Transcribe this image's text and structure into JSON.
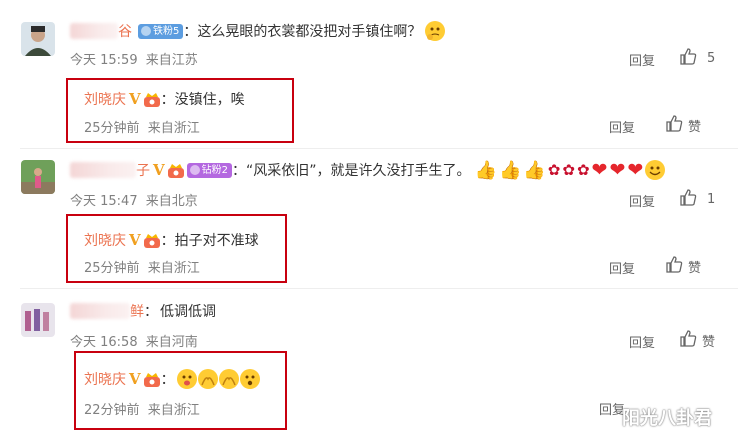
{
  "comments": [
    {
      "user_visible": "谷",
      "badge": "铁粉5",
      "text": "这么晃眼的衣裳都没把对手镇住啊？",
      "time": "今天 15:59",
      "location": "来自江苏",
      "reply_label": "回复",
      "like_count": "5",
      "reply": {
        "user": "刘晓庆",
        "text": "没镇住，唉",
        "time": "25分钟前",
        "location": "来自浙江",
        "reply_label": "回复",
        "like_label": "赞"
      }
    },
    {
      "user_visible": "子",
      "badge": "钻粉2",
      "text": "“风采依旧”，就是许久没打手生了。",
      "time": "今天 15:47",
      "location": "来自北京",
      "reply_label": "回复",
      "like_count": "1",
      "reply": {
        "user": "刘晓庆",
        "text": "拍子对不准球",
        "time": "25分钟前",
        "location": "来自浙江",
        "reply_label": "回复",
        "like_label": "赞"
      }
    },
    {
      "user_visible": "鲜",
      "text": "低调低调",
      "time": "今天 16:58",
      "location": "来自河南",
      "reply_label": "回复",
      "like_label": "赞",
      "reply": {
        "user": "刘晓庆",
        "text": "",
        "time": "22分钟前",
        "location": "来自浙江",
        "reply_label": "回复",
        "like_label": "赞"
      }
    }
  ],
  "separator": "：",
  "verified_mark": "V",
  "watermark": "阳光八卦君",
  "colors": {
    "name": "#eb7350",
    "highlight_box": "#c8000f",
    "meta": "#808080"
  }
}
